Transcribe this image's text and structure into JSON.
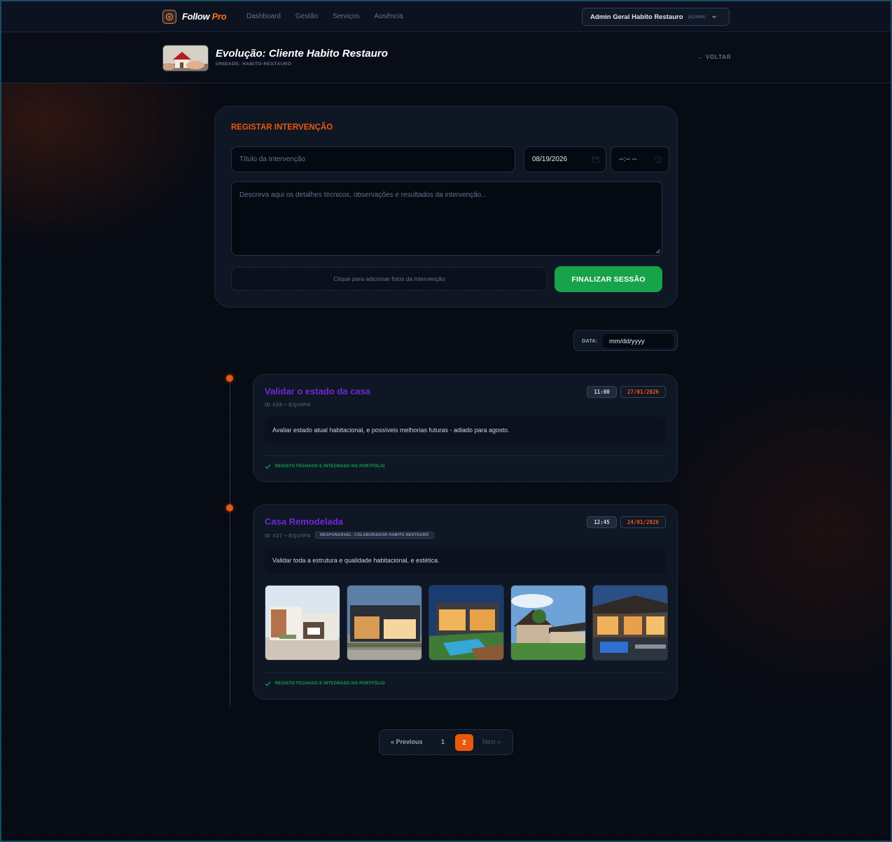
{
  "nav": {
    "brand_main": "Follow",
    "brand_accent": "Pro",
    "links": [
      "Dashboard",
      "Gestão",
      "Serviços",
      "Ausência"
    ],
    "user_name": "Admin Geral Habito Restauro",
    "user_role": "(ADMIN)"
  },
  "header": {
    "title": "Evolução: Cliente Habito Restauro",
    "unit": "UNIDADE: HABITO-RESTAURO",
    "back": "← VOLTAR"
  },
  "form": {
    "heading": "REGISTAR INTERVENÇÃO",
    "title_placeholder": "Título da Intervenção",
    "date_value": "08/19/2026",
    "time_value": "--:-- --",
    "desc_placeholder": "Descreva aqui os detalhes técnicos, observações e resultados da intervenção...",
    "photo_prompt": "Clique para adicionar fotos da intervenção",
    "submit": "FINALIZAR SESSÃO"
  },
  "filter": {
    "label": "DATA:",
    "value": "mm/dd/yyyy"
  },
  "entries": [
    {
      "title": "Validar o estado da casa",
      "meta": "ID #28 • EQUIPA",
      "time": "11:00",
      "date": "27/01/2026",
      "description": "Avaliar estado atual habitacional, e possíveis melhorias futuras - adiado para agosto.",
      "status": "REGISTO FECHADO E INTEGRADO NO PORTFÓLIO"
    },
    {
      "title": "Casa Remodelada",
      "meta": "ID #27 • EQUIPA",
      "responsible": "RESPONSÁVEL: COLABORADOR HABITO RESTAURO",
      "time": "12:45",
      "date": "24/01/2026",
      "description": "Validar toda a estrutura e qualidade habitacional, e estética.",
      "status": "REGISTO FECHADO E INTEGRADO NO PORTFÓLIO"
    }
  ],
  "pagination": {
    "prev": "« Previous",
    "pages": [
      "1",
      "2"
    ],
    "current": "2",
    "next": "Next »"
  },
  "colors": {
    "accent": "#ea580c",
    "success": "#16a34a",
    "entry_title": "#6d28d9"
  }
}
